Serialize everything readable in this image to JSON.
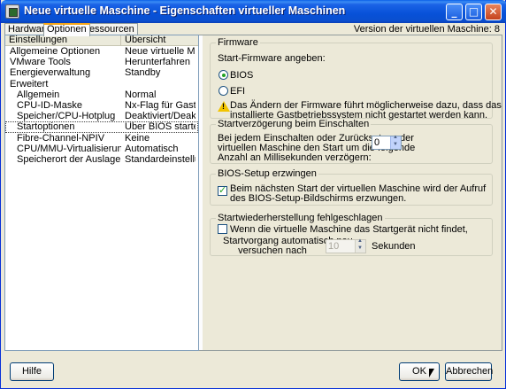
{
  "window": {
    "title": "Neue virtuelle Maschine - Eigenschaften virtueller Maschinen",
    "minimize_glyph": "_",
    "maximize_glyph": "□",
    "close_glyph": "✕"
  },
  "tabs": [
    {
      "label": "Hardware"
    },
    {
      "label": "Optionen"
    },
    {
      "label": "Ressourcen"
    }
  ],
  "version_text": "Version der virtuellen Maschine: 8",
  "list": {
    "header": {
      "col1": "Einstellungen",
      "col2": "Übersicht"
    },
    "rows": [
      {
        "name": "Allgemeine Optionen",
        "value": "Neue virtuelle Mas..."
      },
      {
        "name": "VMware Tools",
        "value": "Herunterfahren"
      },
      {
        "name": "Energieverwaltung",
        "value": "Standby"
      },
      {
        "name": "Erweitert",
        "value": ""
      },
      {
        "name": "Allgemein",
        "value": "Normal"
      },
      {
        "name": "CPU-ID-Maske",
        "value": "Nx-Flag für Gast ei..."
      },
      {
        "name": "Speicher/CPU-Hotplug",
        "value": "Deaktiviert/Deaktiv..."
      },
      {
        "name": "Startoptionen",
        "value": "Über BIOS starten"
      },
      {
        "name": "Fibre-Channel-NPIV",
        "value": "Keine"
      },
      {
        "name": "CPU/MMU-Virtualisierung",
        "value": "Automatisch"
      },
      {
        "name": "Speicherort der Auslagerungsd...",
        "value": "Standardeinstellun..."
      }
    ]
  },
  "firmware": {
    "legend": "Firmware",
    "prompt": "Start-Firmware angeben:",
    "option_bios": "BIOS",
    "option_efi": "EFI",
    "selected": "BIOS",
    "warning_line1": "Das Ändern der Firmware führt möglicherweise dazu, dass das",
    "warning_line2": "installierte Gastbetriebssystem nicht gestartet werden kann."
  },
  "boot_delay": {
    "legend": "Startverzögerung beim Einschalten",
    "line1": "Bei jedem Einschalten oder Zurücksetzen der",
    "line2": "virtuellen Maschine den Start um die folgende",
    "line3": "Anzahl an Millisekunden verzögern:",
    "value": "0"
  },
  "bios_setup": {
    "legend": "BIOS-Setup erzwingen",
    "checked": true,
    "line1": "Beim nächsten Start der virtuellen Maschine wird der Aufruf",
    "line2": "des BIOS-Setup-Bildschirms erzwungen."
  },
  "recovery": {
    "legend": "Startwiederherstellung fehlgeschlagen",
    "checked": false,
    "checkbox_label": "Wenn die virtuelle Maschine das Startgerät nicht findet,",
    "retry_line1": "Startvorgang automatisch neu",
    "retry_line2": "versuchen nach",
    "value": "10",
    "unit": "Sekunden"
  },
  "buttons": {
    "help": "Hilfe",
    "ok": "OK",
    "cancel": "Abbrechen"
  }
}
